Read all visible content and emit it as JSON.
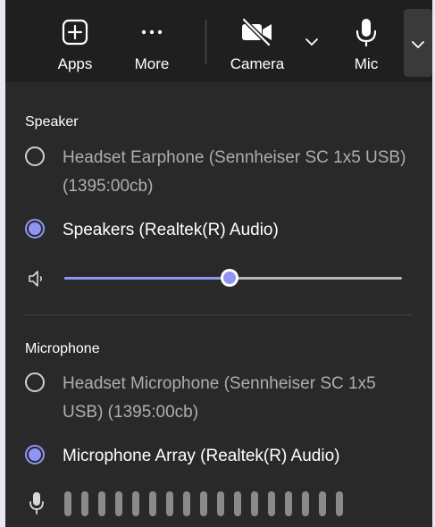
{
  "toolbar": {
    "apps_label": "Apps",
    "more_label": "More",
    "camera_label": "Camera",
    "mic_label": "Mic",
    "icons": {
      "apps": "plus-square-icon",
      "more": "more-dots-icon",
      "camera": "camera-off-icon",
      "camera_options": "chevron-down-icon",
      "mic": "microphone-icon",
      "mic_options": "chevron-down-icon"
    }
  },
  "speaker": {
    "section_label": "Speaker",
    "options": [
      {
        "label": "Headset Earphone (Sennheiser SC 1x5 USB) (1395:00cb)",
        "selected": false
      },
      {
        "label": "Speakers (Realtek(R) Audio)",
        "selected": true
      }
    ],
    "volume": {
      "icon": "speaker-icon",
      "level": 0.49
    }
  },
  "microphone": {
    "section_label": "Microphone",
    "options": [
      {
        "label": "Headset Microphone (Sennheiser SC 1x5 USB) (1395:00cb)",
        "selected": false
      },
      {
        "label": "Microphone Array (Realtek(R) Audio)",
        "selected": true
      }
    ],
    "level_meter": {
      "icon": "microphone-icon",
      "segments": 17,
      "active_segments": 0
    }
  },
  "colors": {
    "accent": "#8f95f2",
    "panel_background": "#292929",
    "toolbar_background": "#1f1f1f",
    "text_primary": "#ffffff",
    "text_secondary": "#aeaeae"
  }
}
